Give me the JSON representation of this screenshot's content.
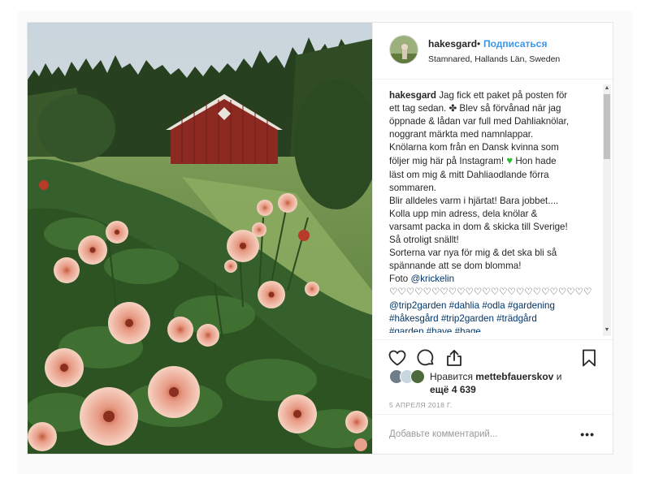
{
  "post": {
    "username": "hakesgard",
    "separator": "•",
    "follow_label": "Подписаться",
    "location": "Stamnared, Hallands Län, Sweden",
    "caption": {
      "username": "hakesgard",
      "first_line": "Jag fick ett paket på posten för",
      "lines": [
        "ett tag sedan. ✤ Blev så förvånad när jag",
        "öppnade & lådan var full med Dahliaknölar,",
        "noggrant märkta med namnlappar.",
        "Knölarna kom från en Dansk kvinna som",
        "följer mig här på Instagram!"
      ],
      "heart_tail": "Hon hade",
      "lines2": [
        "läst om mig & mitt Dahliaodlande förra",
        "sommaren.",
        "Blir alldeles varm i hjärtat! Bara jobbet....",
        "Kolla upp min adress, dela knölar &",
        "varsamt packa in dom & skicka till Sverige!",
        "Så otroligt snällt!",
        "Sorterna var nya för mig & det ska bli så",
        "spännande att se dom blomma!"
      ],
      "photo_prefix": "Foto",
      "photo_credit": "@krickelin",
      "hearts_row": "♡♡♡♡♡♡♡♡♡♡♡♡♡♡♡♡♡♡♡♡♡♡♡♡♡♡♡",
      "tags": [
        [
          "@trip2garden",
          "#dahlia",
          "#odla",
          "#gardening"
        ],
        [
          "#håkesgård",
          "#trip2garden",
          "#trädgård"
        ],
        [
          "#garden",
          "#have",
          "#hage"
        ]
      ]
    },
    "likes": {
      "prefix": "Нравится",
      "user": "mettebfauerskov",
      "conj": "и",
      "more_prefix": "ещё",
      "count": "4 639"
    },
    "date": "5 апреля 2018 г.",
    "comment_placeholder": "Добавьте комментарий...",
    "more_icon": "•••"
  },
  "icons": [
    "heart-icon",
    "comment-icon",
    "share-icon",
    "bookmark-icon",
    "green-heart-icon",
    "flower-icon"
  ],
  "colors": {
    "follow": "#3897f0",
    "link": "#003569",
    "meta": "#999999",
    "green_heart": "#2eb82e",
    "barn": "#8c2a22"
  }
}
